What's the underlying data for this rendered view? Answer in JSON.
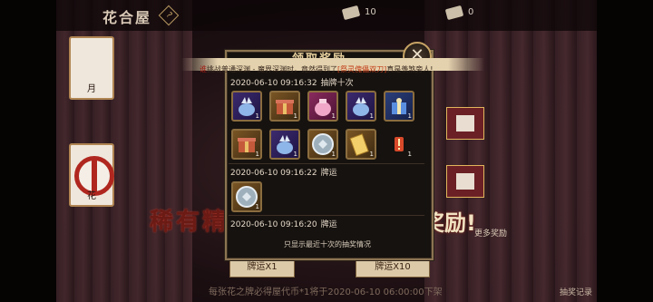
{
  "header": {
    "title": "花合屋",
    "resource1_value": "10",
    "resource2_value": "0"
  },
  "sidebar": {
    "tabs": [
      {
        "label": "月"
      },
      {
        "label": "花"
      }
    ]
  },
  "background": {
    "banner_left": "稀有精",
    "banner_right": "奖励!",
    "more_rewards": "更多奖励",
    "draw_one_label": "牌运X1",
    "draw_ten_label": "牌运X10",
    "record_label": "抽奖记录",
    "bottom_note": "每张花之牌必得屋代币*1将于2020-06-10 06:00:00下架"
  },
  "popup": {
    "title": "领取奖励",
    "close_symbol": "✕",
    "marquee_prefix": "谁",
    "marquee_mid": "挑战普通深渊 - 魔界深渊时，竟然得到了",
    "marquee_item": "[祭灵傀儡双刀]",
    "marquee_suffix": "真是羡煞旁人!",
    "entries": [
      {
        "timestamp": "2020-06-10 09:16:32",
        "type": "抽牌十次",
        "items": [
          {
            "icon": "blue-crystal-icon",
            "count": "1"
          },
          {
            "icon": "gift-box-icon",
            "count": "1"
          },
          {
            "icon": "pink-pouch-icon",
            "count": "1"
          },
          {
            "icon": "blue-crystal-icon",
            "count": "1"
          },
          {
            "icon": "blue-giftbox-icon",
            "count": "1"
          },
          {
            "icon": "gift-box-icon",
            "count": "1"
          },
          {
            "icon": "blue-crystal-icon",
            "count": "1"
          },
          {
            "icon": "silver-coin-icon",
            "count": "1"
          },
          {
            "icon": "golden-ticket-icon",
            "count": "1"
          },
          {
            "icon": "exclamation-icon",
            "count": "1"
          }
        ]
      },
      {
        "timestamp": "2020-06-10 09:16:22",
        "type": "牌运",
        "items": [
          {
            "icon": "silver-coin-icon",
            "count": "1"
          }
        ]
      },
      {
        "timestamp": "2020-06-10 09:16:20",
        "type": "牌运",
        "items": []
      }
    ],
    "footer": "只显示最近十次的抽奖情况"
  },
  "colors": {
    "panel_border": "#8d7552",
    "accent_gold": "#e6cf9d",
    "item_name_red": "#c2401b"
  }
}
